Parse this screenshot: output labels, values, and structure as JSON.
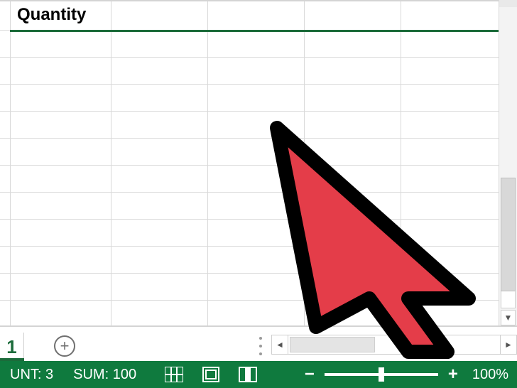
{
  "sheet": {
    "header_label": "Quantity",
    "active_tab_suffix": "1"
  },
  "scroll": {
    "h_left_glyph": "◄",
    "h_right_glyph": "►",
    "v_down_glyph": "▼"
  },
  "status": {
    "count_label": "UNT:",
    "count_value": "3",
    "sum_label": "SUM:",
    "sum_value": "100",
    "zoom_value": "100%",
    "minus": "−",
    "plus": "+"
  },
  "icons": {
    "new_sheet_plus": "+"
  }
}
